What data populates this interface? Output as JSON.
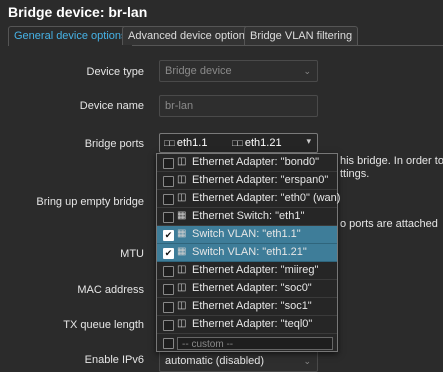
{
  "page": {
    "title": "Bridge device: br-lan"
  },
  "tabs": [
    {
      "label": "General device options",
      "active": true
    },
    {
      "label": "Advanced device options",
      "active": false
    },
    {
      "label": "Bridge VLAN filtering",
      "active": false
    }
  ],
  "form": {
    "device_type": {
      "label": "Device type",
      "value": "Bridge device"
    },
    "device_name": {
      "label": "Device name",
      "value": "br-lan"
    },
    "bridge_ports": {
      "label": "Bridge ports",
      "chips": [
        "eth1.1",
        "eth1.21"
      ]
    },
    "bring_up_empty": {
      "label": "Bring up empty bridge"
    },
    "mtu": {
      "label": "MTU"
    },
    "mac": {
      "label": "MAC address"
    },
    "txqueue": {
      "label": "TX queue length"
    },
    "ipv6": {
      "label": "Enable IPv6",
      "value": "automatic (disabled)"
    }
  },
  "descriptions": {
    "ports_line1": "his bridge. In order to atta",
    "ports_line2": "ttings.",
    "empty_line": "o ports are attached"
  },
  "dropdown": {
    "options": [
      {
        "icon": "ethernet-adapter-icon",
        "label": "Ethernet Adapter: \"bond0\"",
        "checked": false
      },
      {
        "icon": "ethernet-adapter-icon",
        "label": "Ethernet Adapter: \"erspan0\"",
        "checked": false
      },
      {
        "icon": "ethernet-adapter-icon",
        "label": "Ethernet Adapter: \"eth0\" (wan)",
        "checked": false
      },
      {
        "icon": "ethernet-switch-icon",
        "label": "Ethernet Switch: \"eth1\"",
        "checked": false
      },
      {
        "icon": "switch-vlan-icon",
        "label": "Switch VLAN: \"eth1.1\"",
        "checked": true
      },
      {
        "icon": "switch-vlan-icon",
        "label": "Switch VLAN: \"eth1.21\"",
        "checked": true
      },
      {
        "icon": "ethernet-adapter-icon",
        "label": "Ethernet Adapter: \"miireg\"",
        "checked": false
      },
      {
        "icon": "ethernet-adapter-icon",
        "label": "Ethernet Adapter: \"soc0\"",
        "checked": false
      },
      {
        "icon": "ethernet-adapter-icon",
        "label": "Ethernet Adapter: \"soc1\"",
        "checked": false
      },
      {
        "icon": "ethernet-adapter-icon",
        "label": "Ethernet Adapter: \"teql0\"",
        "checked": false
      }
    ],
    "custom_placeholder": "-- custom --"
  },
  "colors": {
    "accent": "#46b2e6",
    "selected_row": "#3e7d99",
    "background": "#2b2b2b"
  }
}
